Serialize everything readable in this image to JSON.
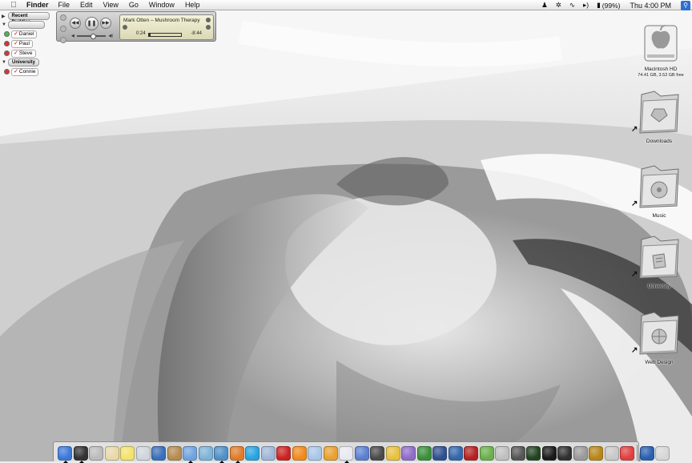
{
  "menubar": {
    "apple_icon": "apple-icon",
    "app_name": "Finder",
    "menus": [
      "File",
      "Edit",
      "View",
      "Go",
      "Window",
      "Help"
    ],
    "battery": "(99%)",
    "clock": "Thu 4:00 PM",
    "status_icons": [
      "ichat-status-icon",
      "bluetooth-icon",
      "wifi-icon",
      "volume-icon",
      "battery-icon",
      "spotlight-icon"
    ]
  },
  "buddy_list": {
    "groups": [
      {
        "name": "Recent Buddies",
        "expanded": false,
        "buddies": []
      },
      {
        "name": "",
        "expanded": true,
        "buddies": [
          {
            "name": "Daniel",
            "status": "available"
          },
          {
            "name": "Paul",
            "status": "away"
          },
          {
            "name": "Steve",
            "status": "away"
          }
        ]
      },
      {
        "name": "University",
        "expanded": true,
        "buddies": [
          {
            "name": "Connie",
            "status": "away"
          }
        ]
      }
    ]
  },
  "itunes": {
    "track": "Mark Otten – Mushroom Therapy",
    "elapsed": "0:24",
    "remaining": "-8:44",
    "progress_fraction": 0.05,
    "volume_fraction": 0.55
  },
  "desktop": {
    "disk": {
      "name": "Macintosh HD",
      "capacity": "74.41 GB, 3.52 GB free"
    },
    "aliases": [
      "Downloads",
      "Music",
      "University",
      "Web Design"
    ]
  },
  "dock": {
    "apps": [
      {
        "icon": "finder-icon",
        "color": "#3d78d8",
        "run": true
      },
      {
        "icon": "dashboard-icon",
        "color": "#333333",
        "run": true
      },
      {
        "icon": "system-prefs-icon",
        "color": "#bbbbbb",
        "run": false
      },
      {
        "icon": "textedit-icon",
        "color": "#e8d9a8",
        "run": false
      },
      {
        "icon": "stickies-icon",
        "color": "#f2e36c",
        "run": false
      },
      {
        "icon": "mail-icon",
        "color": "#d0d4dc",
        "run": false
      },
      {
        "icon": "ical-icon",
        "color": "#3a6fb8",
        "run": false
      },
      {
        "icon": "address-book-icon",
        "color": "#b58b52",
        "run": false
      },
      {
        "icon": "ichat-icon",
        "color": "#6fa3e0",
        "run": true
      },
      {
        "icon": "iphoto-icon",
        "color": "#7db3d8",
        "run": false
      },
      {
        "icon": "itunes-icon",
        "color": "#4f8fc7",
        "run": true
      },
      {
        "icon": "firefox-icon",
        "color": "#e07c2a",
        "run": true
      },
      {
        "icon": "skype-icon",
        "color": "#29a3e0",
        "run": false
      },
      {
        "icon": "preview-icon",
        "color": "#9fb6d8",
        "run": false
      },
      {
        "icon": "opera-icon",
        "color": "#cc2222",
        "run": false
      },
      {
        "icon": "vlc-icon",
        "color": "#f08a1c",
        "run": false
      },
      {
        "icon": "photoshop-icon",
        "color": "#a9c6e8",
        "run": false
      },
      {
        "icon": "illustrator-icon",
        "color": "#e8a030",
        "run": false
      },
      {
        "icon": "safari-icon",
        "color": "#e8e8f0",
        "run": true
      },
      {
        "icon": "colorsync-icon",
        "color": "#5a7fd0",
        "run": false
      },
      {
        "icon": "network-utility-icon",
        "color": "#4a4a4a",
        "run": false
      },
      {
        "icon": "cyberduck-icon",
        "color": "#e8c040",
        "run": false
      },
      {
        "icon": "dvd-player-icon",
        "color": "#8e6cc8",
        "run": false
      },
      {
        "icon": "adium-icon",
        "color": "#3a8f3a",
        "run": false
      },
      {
        "icon": "world-icon",
        "color": "#2f4f8f",
        "run": false
      },
      {
        "icon": "google-earth-icon",
        "color": "#3366aa",
        "run": false
      },
      {
        "icon": "magnet-icon",
        "color": "#b32222",
        "run": false
      },
      {
        "icon": "transmit-icon",
        "color": "#6ab04c",
        "run": false
      },
      {
        "icon": "keychain-icon",
        "color": "#bfbfbf",
        "run": false
      },
      {
        "icon": "console-icon",
        "color": "#555555",
        "run": false
      },
      {
        "icon": "activity-monitor-icon",
        "color": "#224422",
        "run": false
      },
      {
        "icon": "terminal-icon",
        "color": "#1a1a1a",
        "run": false
      },
      {
        "icon": "grapher-icon",
        "color": "#303030",
        "run": false
      },
      {
        "icon": "disk-utility-icon",
        "color": "#9a9a9a",
        "run": false
      },
      {
        "icon": "world-of-warcraft-icon",
        "color": "#b8861a",
        "run": false
      },
      {
        "icon": "font-book-icon",
        "color": "#c8c8c8",
        "run": false
      },
      {
        "icon": "pin-icon",
        "color": "#e04040",
        "run": false
      }
    ],
    "docs": [
      {
        "icon": "vs-document-icon",
        "color": "#2a5fb0"
      },
      {
        "icon": "trash-icon",
        "color": "#d6d6d6"
      }
    ]
  }
}
